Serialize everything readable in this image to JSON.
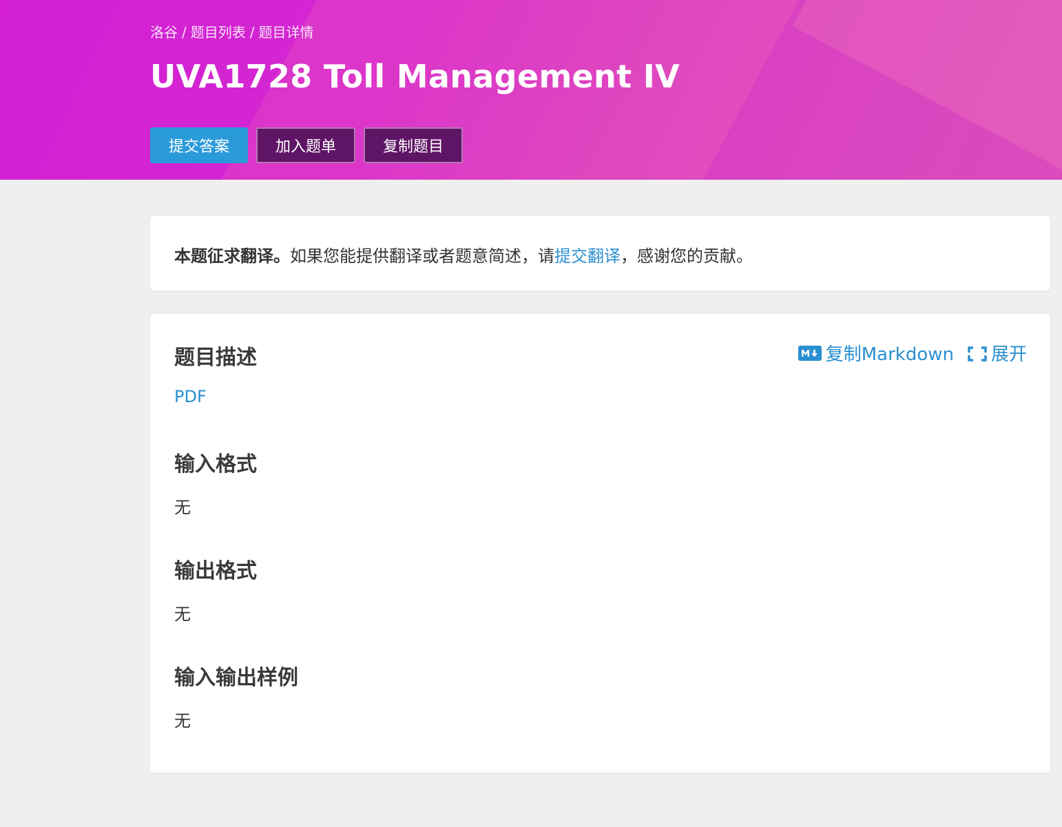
{
  "header": {
    "breadcrumb": [
      "洛谷",
      "题目列表",
      "题目详情"
    ],
    "separator": "/",
    "title": "UVA1728 Toll Management IV",
    "buttons": {
      "submit": "提交答案",
      "add_to_list": "加入题单",
      "copy_problem": "复制题目"
    }
  },
  "notice": {
    "strong": "本题征求翻译。",
    "text_before": "如果您能提供翻译或者题意简述，请",
    "link": "提交翻译",
    "text_after": "，感谢您的贡献。"
  },
  "problem": {
    "tools": {
      "copy_markdown": "复制Markdown",
      "expand": "展开"
    },
    "sections": {
      "description": {
        "heading": "题目描述",
        "link": "PDF"
      },
      "input": {
        "heading": "输入格式",
        "body": "无"
      },
      "output": {
        "heading": "输出格式",
        "body": "无"
      },
      "samples": {
        "heading": "输入输出样例",
        "body": "无"
      }
    }
  },
  "colors": {
    "primary": "#2a9ad8",
    "link": "#2a8fd1",
    "dark_button": "#5f1566",
    "header_gradient_start": "#d21fd6",
    "header_gradient_end": "#dc4bbd",
    "background": "#efefef"
  },
  "icons": {
    "markdown": "markdown-icon",
    "expand": "expand-icon"
  }
}
